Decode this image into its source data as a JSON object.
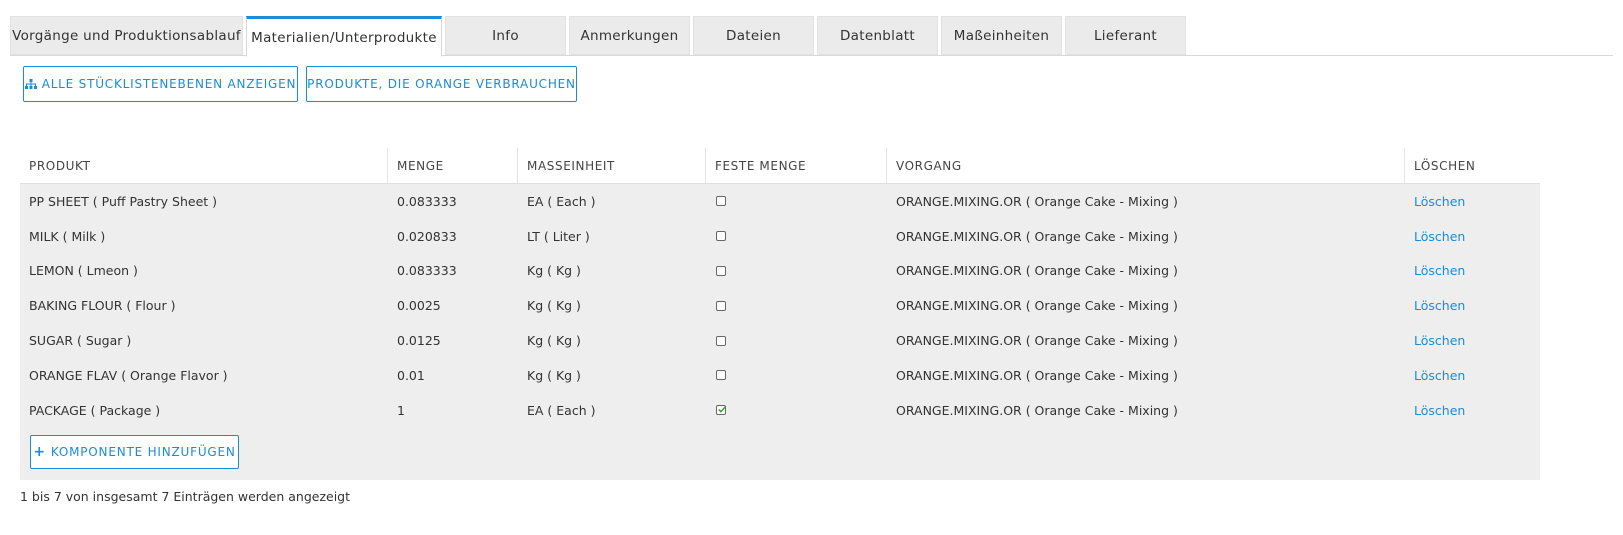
{
  "tabs": [
    {
      "label": "Vorgänge und Produktionsablauf",
      "active": false
    },
    {
      "label": "Materialien/Unterprodukte",
      "active": true
    },
    {
      "label": "Info",
      "active": false
    },
    {
      "label": "Anmerkungen",
      "active": false
    },
    {
      "label": "Dateien",
      "active": false
    },
    {
      "label": "Datenblatt",
      "active": false
    },
    {
      "label": "Maßeinheiten",
      "active": false
    },
    {
      "label": "Lieferant",
      "active": false
    }
  ],
  "toolbar": {
    "show_all_levels_label": "ALLE STÜCKLISTENEBENEN ANZEIGEN",
    "show_all_levels_icon": "sitemap-icon",
    "consumers_label": "PRODUKTE, DIE ORANGE VERBRAUCHEN"
  },
  "table": {
    "headers": [
      "PRODUKT",
      "MENGE",
      "MASSEINHEIT",
      "FESTE MENGE",
      "VORGANG",
      "LÖSCHEN"
    ],
    "rows": [
      {
        "produkt": "PP SHEET ( Puff Pastry Sheet )",
        "menge": "0.083333",
        "einheit": "EA ( Each )",
        "feste_menge": false,
        "vorgang": "ORANGE.MIXING.OR ( Orange Cake - Mixing )",
        "loeschen": "Löschen"
      },
      {
        "produkt": "MILK ( Milk )",
        "menge": "0.020833",
        "einheit": "LT ( Liter )",
        "feste_menge": false,
        "vorgang": "ORANGE.MIXING.OR ( Orange Cake - Mixing )",
        "loeschen": "Löschen"
      },
      {
        "produkt": "LEMON ( Lmeon )",
        "menge": "0.083333",
        "einheit": "Kg ( Kg )",
        "feste_menge": false,
        "vorgang": "ORANGE.MIXING.OR ( Orange Cake - Mixing )",
        "loeschen": "Löschen"
      },
      {
        "produkt": "BAKING FLOUR ( Flour )",
        "menge": "0.0025",
        "einheit": "Kg ( Kg )",
        "feste_menge": false,
        "vorgang": "ORANGE.MIXING.OR ( Orange Cake - Mixing )",
        "loeschen": "Löschen"
      },
      {
        "produkt": "SUGAR ( Sugar )",
        "menge": "0.0125",
        "einheit": "Kg ( Kg )",
        "feste_menge": false,
        "vorgang": "ORANGE.MIXING.OR ( Orange Cake - Mixing )",
        "loeschen": "Löschen"
      },
      {
        "produkt": "ORANGE FLAV ( Orange Flavor )",
        "menge": "0.01",
        "einheit": "Kg ( Kg )",
        "feste_menge": false,
        "vorgang": "ORANGE.MIXING.OR ( Orange Cake - Mixing )",
        "loeschen": "Löschen"
      },
      {
        "produkt": "PACKAGE ( Package )",
        "menge": "1",
        "einheit": "EA ( Each )",
        "feste_menge": true,
        "vorgang": "ORANGE.MIXING.OR ( Orange Cake - Mixing )",
        "loeschen": "Löschen"
      }
    ]
  },
  "add_component_label": "KOMPONENTE HINZUFÜGEN",
  "add_component_icon": "plus-icon",
  "entries_info": "1 bis 7 von insgesamt 7 Einträgen werden angezeigt",
  "colors": {
    "accent": "#1a8cd8",
    "check_green": "#3a9a3a",
    "row_bg": "#eeeeee",
    "tab_bg": "#ebebeb"
  }
}
